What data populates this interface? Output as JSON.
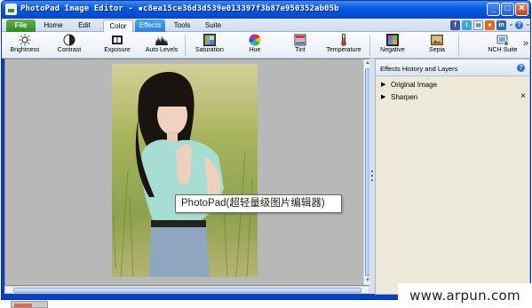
{
  "window": {
    "title": "PhotoPad Image Editor - ▪c8ea15ce36d3d539e013397f3b87e950352ab05b"
  },
  "tabs": [
    {
      "label": "File"
    },
    {
      "label": "Home"
    },
    {
      "label": "Edit"
    },
    {
      "label": "Color"
    },
    {
      "label": "Effects"
    },
    {
      "label": "Tools"
    },
    {
      "label": "Suite"
    }
  ],
  "active_tab": "Color",
  "social_icons": [
    "facebook-icon",
    "twitter-icon",
    "email-icon",
    "nch-icon",
    "linkedin-icon"
  ],
  "toolbar": {
    "tools": [
      {
        "label": "Brightness",
        "icon": "brightness-icon"
      },
      {
        "label": "Contrast",
        "icon": "contrast-icon"
      },
      {
        "label": "Exposure",
        "icon": "exposure-icon"
      },
      {
        "label": "Auto Levels",
        "icon": "auto-levels-icon"
      },
      {
        "label": "Saturation",
        "icon": "saturation-icon"
      },
      {
        "label": "Hue",
        "icon": "hue-icon"
      },
      {
        "label": "Tint",
        "icon": "tint-icon"
      },
      {
        "label": "Temperature",
        "icon": "temperature-icon"
      },
      {
        "label": "Negative",
        "icon": "negative-icon"
      },
      {
        "label": "Sepia",
        "icon": "sepia-icon"
      },
      {
        "label": "NCH Suite",
        "icon": "nch-suite-icon"
      }
    ],
    "more_glyph": "»"
  },
  "panel": {
    "title": "Effects History and Layers",
    "layers": [
      {
        "name": "Original Image",
        "removable": false
      },
      {
        "name": "Sharpen",
        "removable": true
      }
    ]
  },
  "tooltip": "PhotoPad(超轻量级图片编辑器)",
  "watermark": "www.arpun.com",
  "colors": {
    "title_bar": "#0a5ae0",
    "file_tab": "#2f8a1e",
    "effects_tab": "#2f7fd8",
    "workspace_bg": "#b8b8b8",
    "panel_bg": "#ece9d8"
  }
}
